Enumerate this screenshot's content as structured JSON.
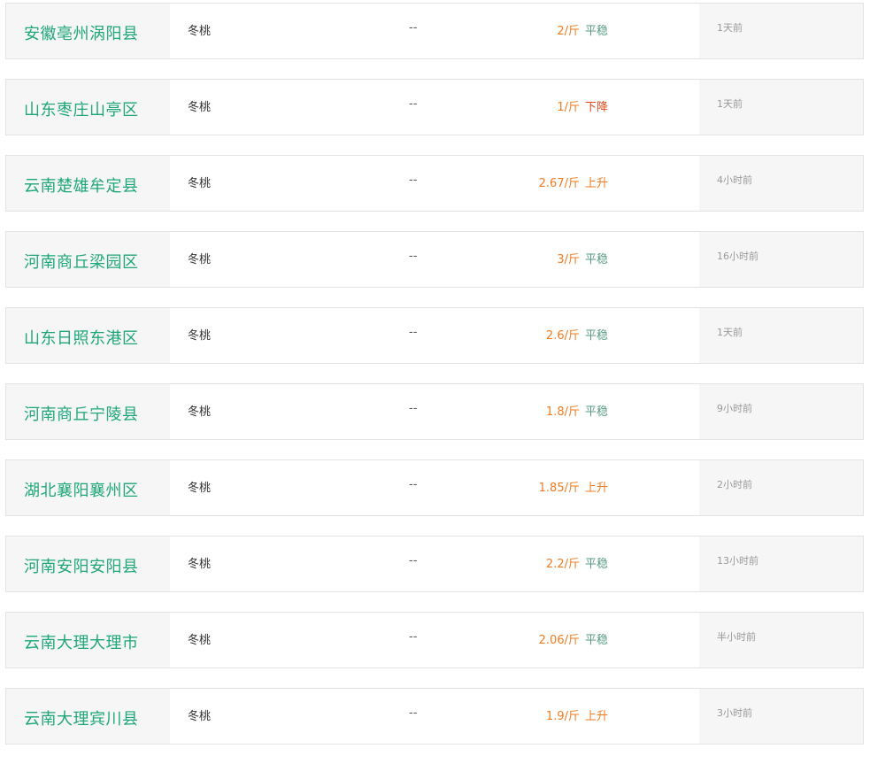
{
  "rows": [
    {
      "location": "安徽亳州涡阳县",
      "variety": "冬桃",
      "spec": "--",
      "price": "2/斤",
      "trend": "平稳",
      "trend_type": "flat",
      "time": "1天前"
    },
    {
      "location": "山东枣庄山亭区",
      "variety": "冬桃",
      "spec": "--",
      "price": "1/斤",
      "trend": "下降",
      "trend_type": "down",
      "time": "1天前"
    },
    {
      "location": "云南楚雄牟定县",
      "variety": "冬桃",
      "spec": "--",
      "price": "2.67/斤",
      "trend": "上升",
      "trend_type": "up",
      "time": "4小时前"
    },
    {
      "location": "河南商丘梁园区",
      "variety": "冬桃",
      "spec": "--",
      "price": "3/斤",
      "trend": "平稳",
      "trend_type": "flat",
      "time": "16小时前"
    },
    {
      "location": "山东日照东港区",
      "variety": "冬桃",
      "spec": "--",
      "price": "2.6/斤",
      "trend": "平稳",
      "trend_type": "flat",
      "time": "1天前"
    },
    {
      "location": "河南商丘宁陵县",
      "variety": "冬桃",
      "spec": "--",
      "price": "1.8/斤",
      "trend": "平稳",
      "trend_type": "flat",
      "time": "9小时前"
    },
    {
      "location": "湖北襄阳襄州区",
      "variety": "冬桃",
      "spec": "--",
      "price": "1.85/斤",
      "trend": "上升",
      "trend_type": "up",
      "time": "2小时前"
    },
    {
      "location": "河南安阳安阳县",
      "variety": "冬桃",
      "spec": "--",
      "price": "2.2/斤",
      "trend": "平稳",
      "trend_type": "flat",
      "time": "13小时前"
    },
    {
      "location": "云南大理大理市",
      "variety": "冬桃",
      "spec": "--",
      "price": "2.06/斤",
      "trend": "平稳",
      "trend_type": "flat",
      "time": "半小时前"
    },
    {
      "location": "云南大理宾川县",
      "variety": "冬桃",
      "spec": "--",
      "price": "1.9/斤",
      "trend": "上升",
      "trend_type": "up",
      "time": "3小时前"
    }
  ],
  "colors": {
    "location": "#1fa67a",
    "price": "#f07c22",
    "trend_flat": "#5a9a86",
    "trend_up": "#f07c22",
    "trend_down": "#e04a1c"
  }
}
